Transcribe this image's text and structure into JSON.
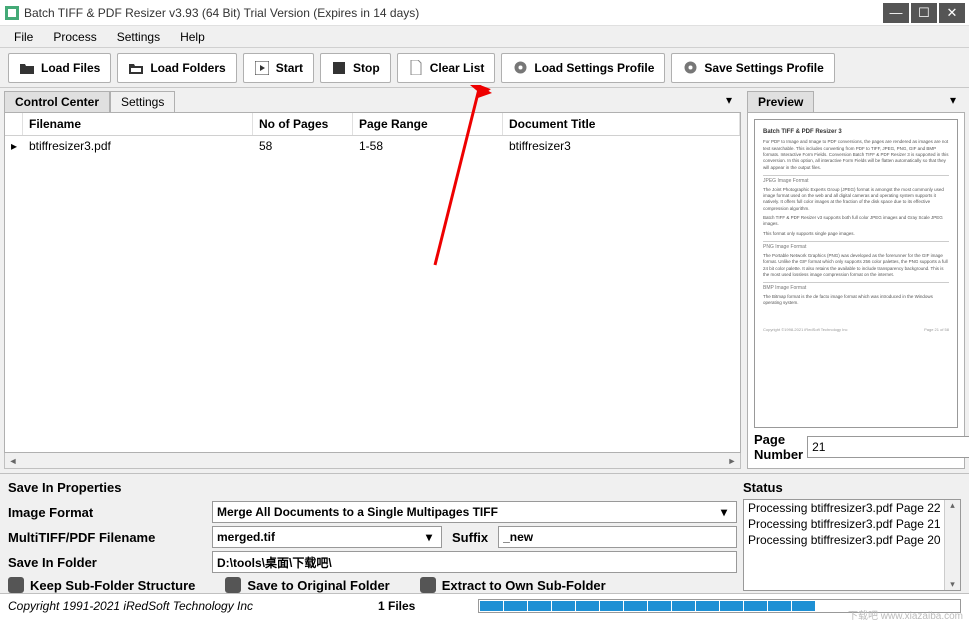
{
  "window": {
    "title": "Batch TIFF & PDF Resizer v3.93 (64 Bit)  Trial Version (Expires in 14 days)"
  },
  "menu": {
    "file": "File",
    "process": "Process",
    "settings": "Settings",
    "help": "Help"
  },
  "toolbar": {
    "load_files": "Load Files",
    "load_folders": "Load Folders",
    "start": "Start",
    "stop": "Stop",
    "clear_list": "Clear List",
    "load_profile": "Load Settings Profile",
    "save_profile": "Save Settings Profile"
  },
  "tabs": {
    "control_center": "Control Center",
    "settings": "Settings",
    "preview": "Preview"
  },
  "grid": {
    "headers": {
      "filename": "Filename",
      "pages": "No of Pages",
      "range": "Page Range",
      "title": "Document Title"
    },
    "rows": [
      {
        "marker": "▸",
        "filename": "btiffresizer3.pdf",
        "pages": "58",
        "range": "1-58",
        "title": "btiffresizer3"
      }
    ]
  },
  "preview": {
    "title": "Batch TIFF & PDF Resizer 3",
    "intro": "For PDF to Image and Image to PDF conversions, the pages are rendered as images are not text searchable. This includes converting from PDF to TIFF, JPEG, PNG, GIF and BMP formats. Interactive Form Fields. Conversion Batch TIFF & PDF Resizer 3 is supported in this conversion. In this option, all interactive Form Fields will be flatten automatically so that they will appear in the output files.",
    "sec1": "JPEG Image Format",
    "txt1": "The Joint Photographic Experts Group (JPEG) format is amongst the most commonly used image format used on the web and all digital cameras and operating system supports it natively. It offers full color images at the fraction of the disk space due to its effective compression algorithm.",
    "txt1b": "Batch TIFF & PDF Resizer v3 supports both full color JPEG images and Gray Scale JPEG images.",
    "txt1c": "This format only supports single page images.",
    "sec2": "PNG Image Format",
    "txt2": "The Portable Network Graphics (PNG) was developed as the forerunner for the GIF image format. Unlike the GIF format which only supports 256 color palettes, the PNG supports a full 24 bit color palette. It also retains the available to include transparency background. This is the most used lossless image compression format on the internet.",
    "sec3": "BMP Image Format",
    "txt3": "The Bitmap format is the de facto image format which was introduced in the Windows operating system.",
    "foot_left": "Copyright ©1998-2021 iRedSoft Technology Inc",
    "foot_right": "Page 21 of 58",
    "page_label": "Page Number",
    "page_value": "21"
  },
  "save": {
    "heading": "Save In Properties",
    "image_format_label": "Image Format",
    "image_format_value": "Merge All Documents to a Single Multipages TIFF",
    "multitiff_label": "MultiTIFF/PDF Filename",
    "multitiff_value": "merged.tif",
    "suffix_label": "Suffix",
    "suffix_value": "_new",
    "folder_label": "Save In Folder",
    "folder_value": "D:\\tools\\桌面\\下载吧\\",
    "chk1": "Keep Sub-Folder Structure",
    "chk2": "Save to Original Folder",
    "chk3": "Extract to Own Sub-Folder"
  },
  "status": {
    "heading": "Status",
    "items": [
      "Processing btiffresizer3.pdf Page 22",
      "Processing btiffresizer3.pdf Page 21",
      "Processing btiffresizer3.pdf Page 20"
    ]
  },
  "footer": {
    "copyright": "Copyright 1991-2021 iRedSoft Technology Inc",
    "files": "1 Files",
    "progress_filled": 14,
    "progress_total": 20
  },
  "watermark": "下载吧 www.xiazaiba.com"
}
